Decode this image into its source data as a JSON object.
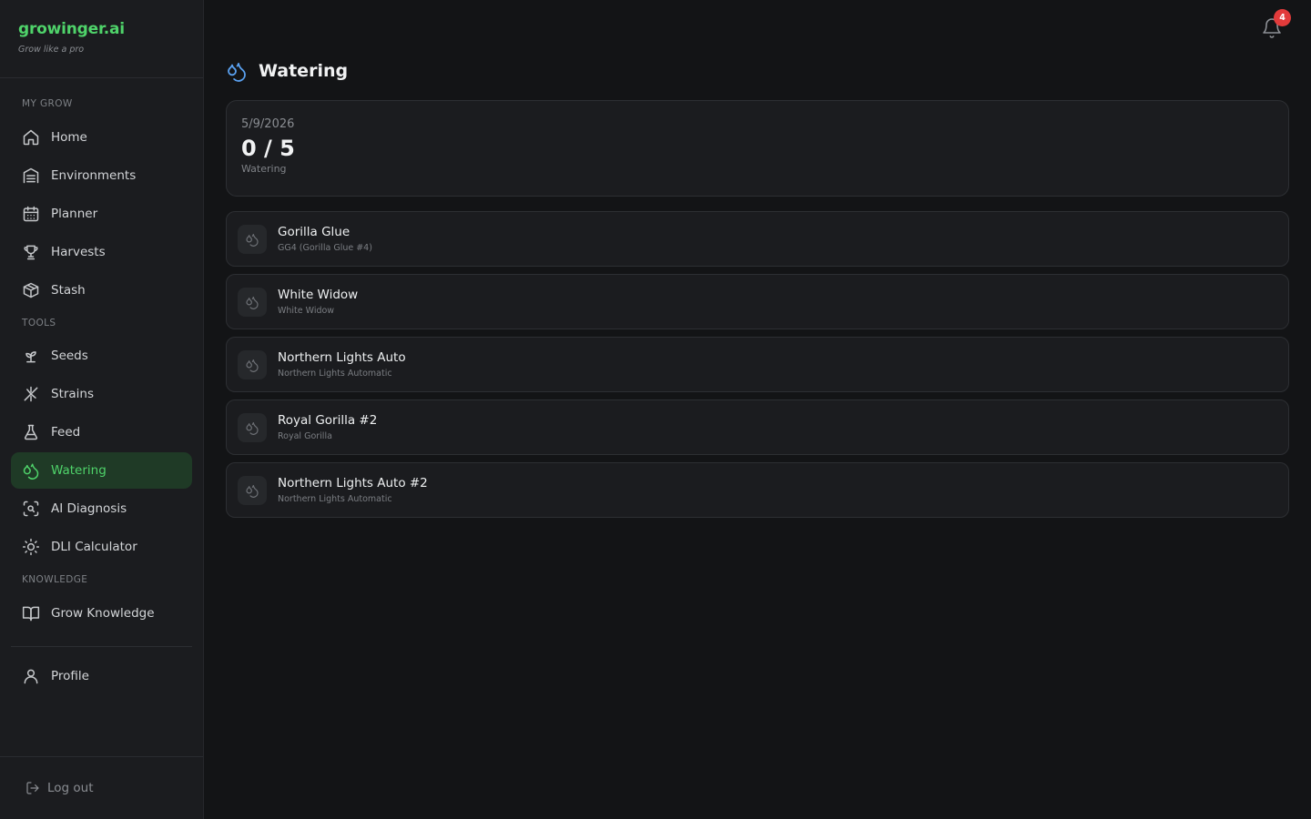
{
  "brand": {
    "name": "growinger.ai",
    "tagline": "Grow like a pro",
    "accent_color": "#4fd36a"
  },
  "sidebar": {
    "sections": {
      "my_grow": "MY GROW",
      "tools": "TOOLS",
      "knowledge": "KNOWLEDGE"
    },
    "items": [
      {
        "label": "Home",
        "icon": "home-icon"
      },
      {
        "label": "Environments",
        "icon": "environments-icon"
      },
      {
        "label": "Planner",
        "icon": "calendar-icon"
      },
      {
        "label": "Harvests",
        "icon": "trophy-icon"
      },
      {
        "label": "Stash",
        "icon": "box-icon"
      },
      {
        "label": "Seeds",
        "icon": "sprout-icon"
      },
      {
        "label": "Strains",
        "icon": "sparkle-icon"
      },
      {
        "label": "Feed",
        "icon": "flask-icon"
      },
      {
        "label": "Watering",
        "icon": "droplets-icon",
        "active": true
      },
      {
        "label": "AI Diagnosis",
        "icon": "scan-icon"
      },
      {
        "label": "DLI Calculator",
        "icon": "sun-icon"
      },
      {
        "label": "Grow Knowledge",
        "icon": "book-icon"
      },
      {
        "label": "Profile",
        "icon": "user-icon"
      }
    ],
    "logout_label": "Log out"
  },
  "header": {
    "notification_count": "4"
  },
  "page": {
    "title": "Watering",
    "icon": "droplets-icon",
    "icon_color": "#5aa1f0"
  },
  "summary": {
    "date": "5/9/2026",
    "count": "0 / 5",
    "label": "Watering"
  },
  "plants": [
    {
      "name": "Gorilla Glue",
      "strain": "GG4 (Gorilla Glue #4)"
    },
    {
      "name": "White Widow",
      "strain": "White Widow"
    },
    {
      "name": "Northern Lights Auto",
      "strain": "Northern Lights Automatic"
    },
    {
      "name": "Royal Gorilla #2",
      "strain": "Royal Gorilla"
    },
    {
      "name": "Northern Lights Auto #2",
      "strain": "Northern Lights Automatic"
    }
  ]
}
